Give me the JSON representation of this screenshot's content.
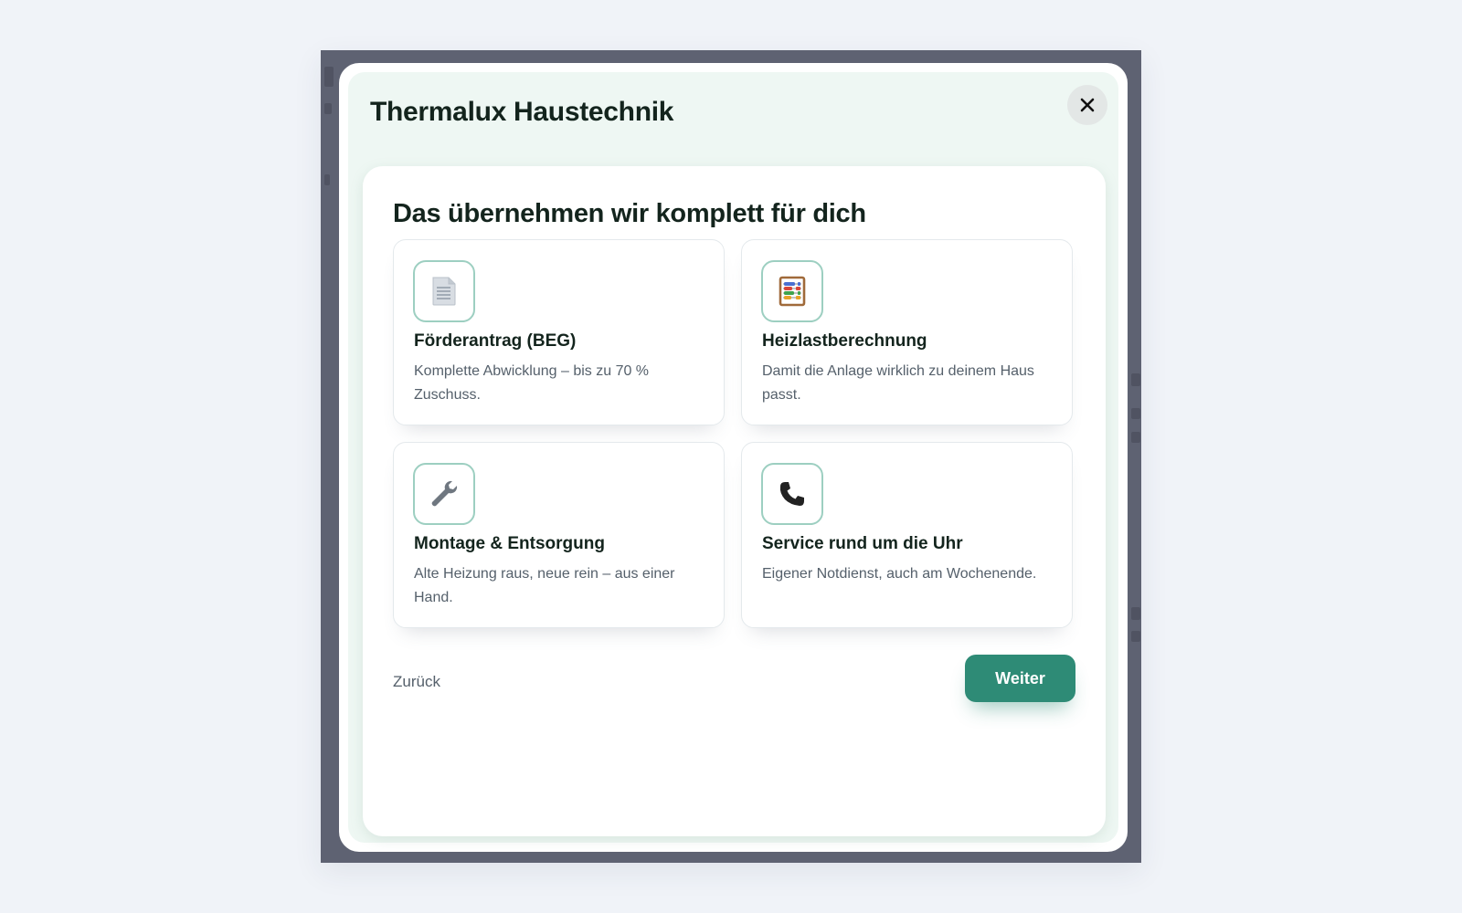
{
  "modal": {
    "brand_title": "Thermalux Haustechnik",
    "close_label": "✕"
  },
  "section": {
    "title": "Das übernehmen wir komplett für dich"
  },
  "tiles": [
    {
      "icon": "document-icon",
      "title": "Förderantrag (BEG)",
      "description": "Komplette Abwicklung – bis zu 70 % Zuschuss."
    },
    {
      "icon": "abacus-icon",
      "title": "Heizlastberechnung",
      "description": "Damit die Anlage wirklich zu deinem Haus passt."
    },
    {
      "icon": "wrench-icon",
      "title": "Montage & Entsorgung",
      "description": "Alte Heizung raus, neue rein – aus einer Hand."
    },
    {
      "icon": "phone-icon",
      "title": "Service rund um die Uhr",
      "description": "Eigener Notdienst, auch am Wochenende."
    }
  ],
  "footer": {
    "back_label": "Zurück",
    "next_label": "Weiter"
  },
  "colors": {
    "accent": "#2e8b76",
    "icon_border": "#9dcfc1",
    "overlay": "#5e6272",
    "modal_tint": "#eef7f3"
  }
}
